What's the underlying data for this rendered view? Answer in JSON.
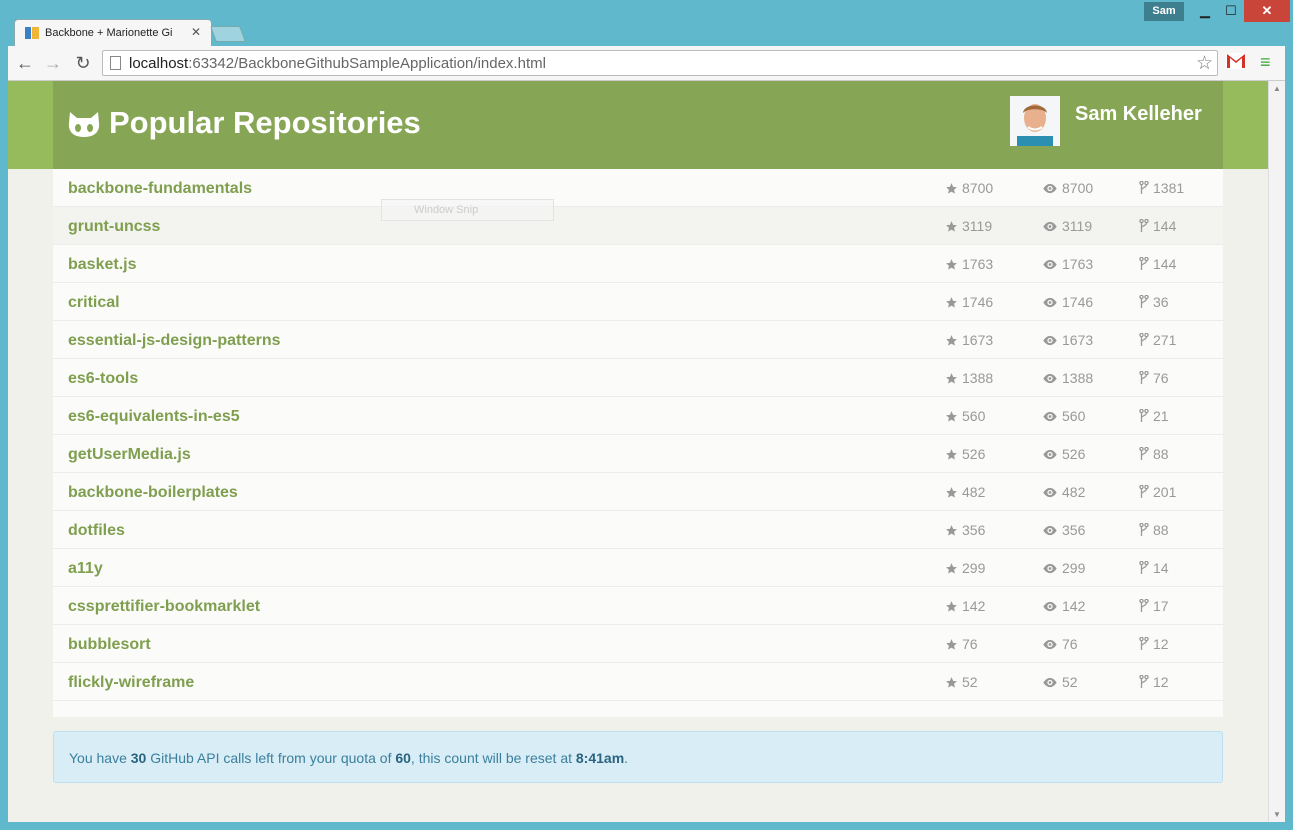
{
  "browser": {
    "tab_title": "Backbone + Marionette Gi",
    "user_badge": "Sam",
    "url_host": "localhost",
    "url_rest": ":63342/BackboneGithubSampleApplication/index.html"
  },
  "header": {
    "title": "Popular Repositories",
    "username": "Sam Kelleher"
  },
  "overlay": {
    "snip_label": "Window Snip"
  },
  "repos": [
    {
      "name": "backbone-fundamentals",
      "stars": "8700",
      "watchers": "8700",
      "forks": "1381"
    },
    {
      "name": "grunt-uncss",
      "stars": "3119",
      "watchers": "3119",
      "forks": "144"
    },
    {
      "name": "basket.js",
      "stars": "1763",
      "watchers": "1763",
      "forks": "144"
    },
    {
      "name": "critical",
      "stars": "1746",
      "watchers": "1746",
      "forks": "36"
    },
    {
      "name": "essential-js-design-patterns",
      "stars": "1673",
      "watchers": "1673",
      "forks": "271"
    },
    {
      "name": "es6-tools",
      "stars": "1388",
      "watchers": "1388",
      "forks": "76"
    },
    {
      "name": "es6-equivalents-in-es5",
      "stars": "560",
      "watchers": "560",
      "forks": "21"
    },
    {
      "name": "getUserMedia.js",
      "stars": "526",
      "watchers": "526",
      "forks": "88"
    },
    {
      "name": "backbone-boilerplates",
      "stars": "482",
      "watchers": "482",
      "forks": "201"
    },
    {
      "name": "dotfiles",
      "stars": "356",
      "watchers": "356",
      "forks": "88"
    },
    {
      "name": "a11y",
      "stars": "299",
      "watchers": "299",
      "forks": "14"
    },
    {
      "name": "cssprettifier-bookmarklet",
      "stars": "142",
      "watchers": "142",
      "forks": "17"
    },
    {
      "name": "bubblesort",
      "stars": "76",
      "watchers": "76",
      "forks": "12"
    },
    {
      "name": "flickly-wireframe",
      "stars": "52",
      "watchers": "52",
      "forks": "12"
    }
  ],
  "quota": {
    "prefix": "You have ",
    "remaining": "30",
    "middle": " GitHub API calls left from your quota of ",
    "limit": "60",
    "suffix_a": ", this count will be reset at ",
    "reset_time": "8:41am",
    "suffix_b": "."
  },
  "colors": {
    "header": "#87a655",
    "link": "#7f9f4f",
    "info_bg": "#d9edf6",
    "info_text": "#3a7f9c"
  },
  "icons": {
    "logo": "octocat-icon",
    "stars": "star-icon",
    "watchers": "eye-icon",
    "forks": "fork-icon"
  }
}
